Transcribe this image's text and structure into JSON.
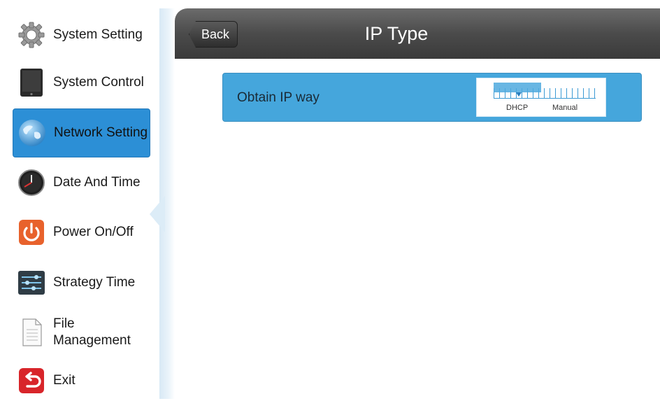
{
  "sidebar": {
    "items": [
      {
        "label": "System Setting",
        "icon": "gear-icon"
      },
      {
        "label": "System Control",
        "icon": "tablet-icon"
      },
      {
        "label": "Network Setting",
        "icon": "globe-icon",
        "active": true
      },
      {
        "label": "Date And Time",
        "icon": "clock-icon"
      },
      {
        "label": "Power On/Off",
        "icon": "power-icon"
      },
      {
        "label": "Strategy Time",
        "icon": "sliders-icon"
      },
      {
        "label": "File Management",
        "icon": "document-icon"
      },
      {
        "label": "Exit",
        "icon": "exit-icon"
      }
    ]
  },
  "header": {
    "back_label": "Back",
    "title": "IP Type"
  },
  "setting": {
    "label": "Obtain IP way",
    "options": [
      "DHCP",
      "Manual"
    ],
    "selected": "DHCP"
  },
  "colors": {
    "accent": "#2c8fd6",
    "row": "#45a6dc",
    "header": "#4b4b4b",
    "power": "#e8622c",
    "exit": "#d8252a"
  }
}
